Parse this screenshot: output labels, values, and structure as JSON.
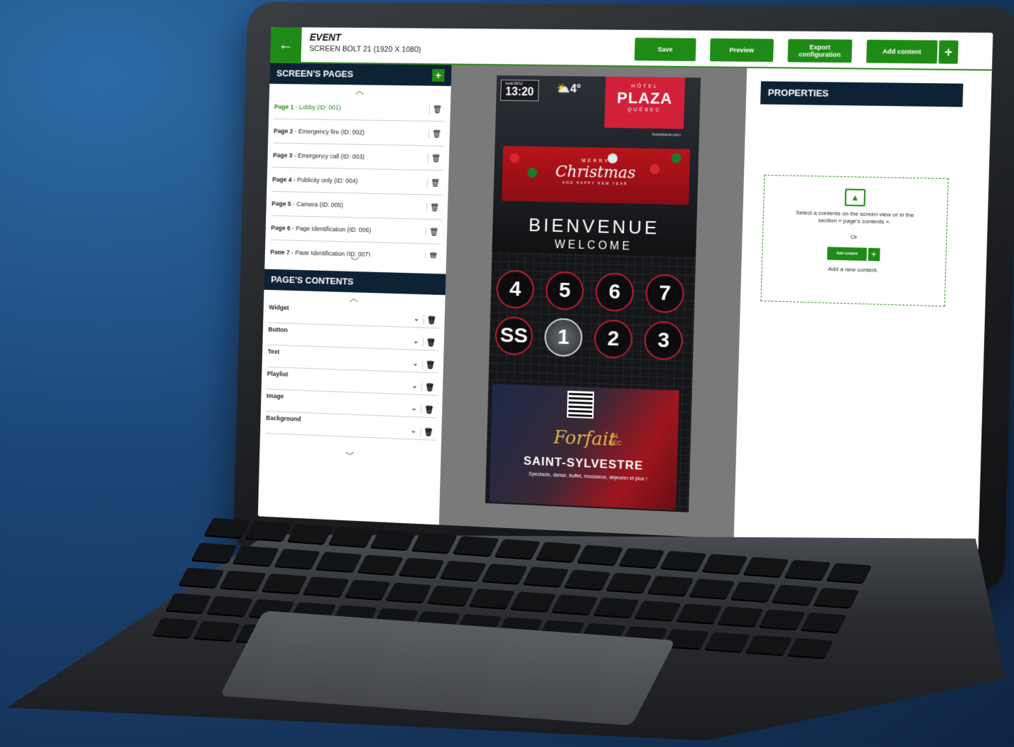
{
  "header": {
    "title": "EVENT",
    "subtitle": "SCREEN BOLT 21 (1920 X 1080)",
    "back_icon": "arrow-left-icon",
    "buttons": {
      "save": "Save",
      "preview": "Preview",
      "export": "Export configuration",
      "add_content": "Add content",
      "plus": "+"
    }
  },
  "screens_pages": {
    "title": "SCREEN'S PAGES",
    "add": "+",
    "pages": [
      {
        "name": "Page 1",
        "desc": " - Lobby (ID: 001)"
      },
      {
        "name": "Page 2",
        "desc": " - Emergency fire (ID: 002)"
      },
      {
        "name": "Page 3",
        "desc": " - Emergency call (ID: 003)"
      },
      {
        "name": "Page 4",
        "desc": " - Publicity only (ID: 004)"
      },
      {
        "name": "Page 5",
        "desc": " - Camera (ID: 005)"
      },
      {
        "name": "Page 6",
        "desc": " - Page Identification (ID: 006)"
      },
      {
        "name": "Page 7",
        "desc": " - Page Identification (ID: 007)"
      }
    ]
  },
  "page_contents": {
    "title": "PAGE'S CONTENTS",
    "items": [
      "Widget",
      "Button",
      "Text",
      "Playlist",
      "Image",
      "Background"
    ]
  },
  "preview": {
    "date": "lundi 05/12",
    "time": "13:20",
    "temperature": "4°",
    "hotel_top": "HÔTEL",
    "hotel_name": "PLAZA",
    "hotel_city": "QUÉBEC",
    "website": "hotelplaza.com",
    "merry": "MERRY",
    "christmas": "Christmas",
    "happy_new_year": "AND HAPPY NEW YEAR",
    "bienvenue": "BIENVENUE",
    "welcome": "WELCOME",
    "floors": [
      "4",
      "5",
      "6",
      "7",
      "SS",
      "1",
      "2",
      "3"
    ],
    "active_floor": "1",
    "forfait": "Forfait",
    "dec_day": "31",
    "dec_month": "DÉC",
    "saint_sylvestre": "SAINT-SYLVESTRE",
    "promo_desc": "Spectacle, danse, buffet, mousseux, déjeuner et plus !"
  },
  "properties": {
    "title": "PROPERTIES",
    "instruction": "Select a contents on the screen view or in the section « page's contents ».",
    "or": "Or",
    "add_content": "Add content",
    "add_new": "Add a new content."
  }
}
